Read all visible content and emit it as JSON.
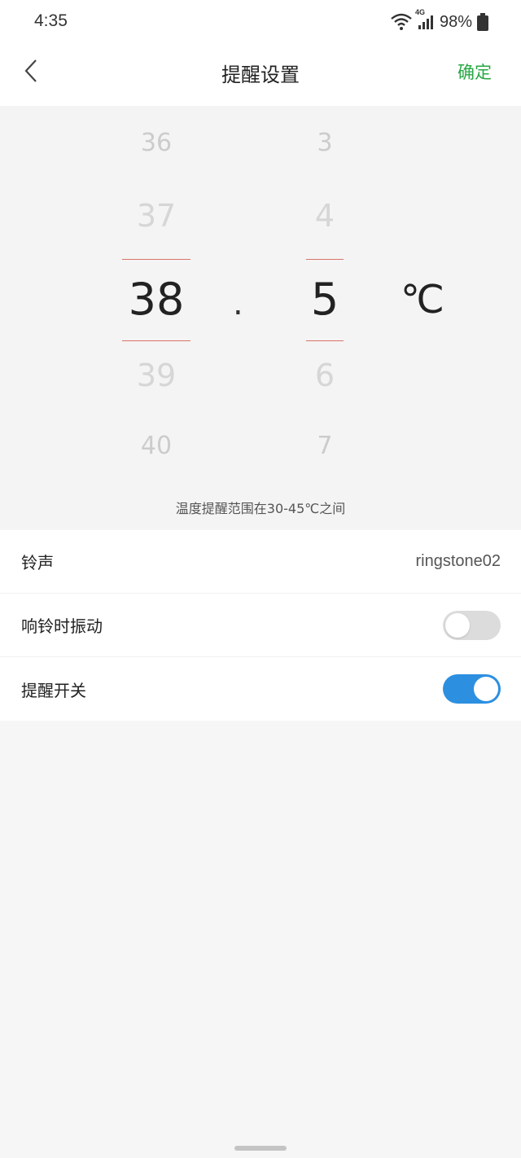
{
  "status_bar": {
    "time": "4:35",
    "network": "4G",
    "battery_percent": "98%",
    "icons": [
      "wifi-icon",
      "signal-icon",
      "battery-icon"
    ]
  },
  "header": {
    "title": "提醒设置",
    "confirm_label": "确定",
    "confirm_color": "#28a745",
    "back_icon": "chevron-left-icon"
  },
  "picker": {
    "integer_column": {
      "above": [
        "36",
        "37"
      ],
      "selected": "38",
      "below": [
        "39",
        "40"
      ]
    },
    "separator": ".",
    "decimal_column": {
      "above": [
        "3",
        "4"
      ],
      "selected": "5",
      "below": [
        "6",
        "7"
      ]
    },
    "unit": "℃",
    "selection_line_color": "#d9736b",
    "range_note": "温度提醒范围在30-45℃之间"
  },
  "settings": {
    "ringtone": {
      "label": "铃声",
      "value": "ringstone02"
    },
    "vibrate": {
      "label": "响铃时振动",
      "enabled": false
    },
    "reminder": {
      "label": "提醒开关",
      "enabled": true
    }
  },
  "colors": {
    "toggle_on": "#2d8fe0",
    "toggle_off": "#dcdcdc"
  }
}
